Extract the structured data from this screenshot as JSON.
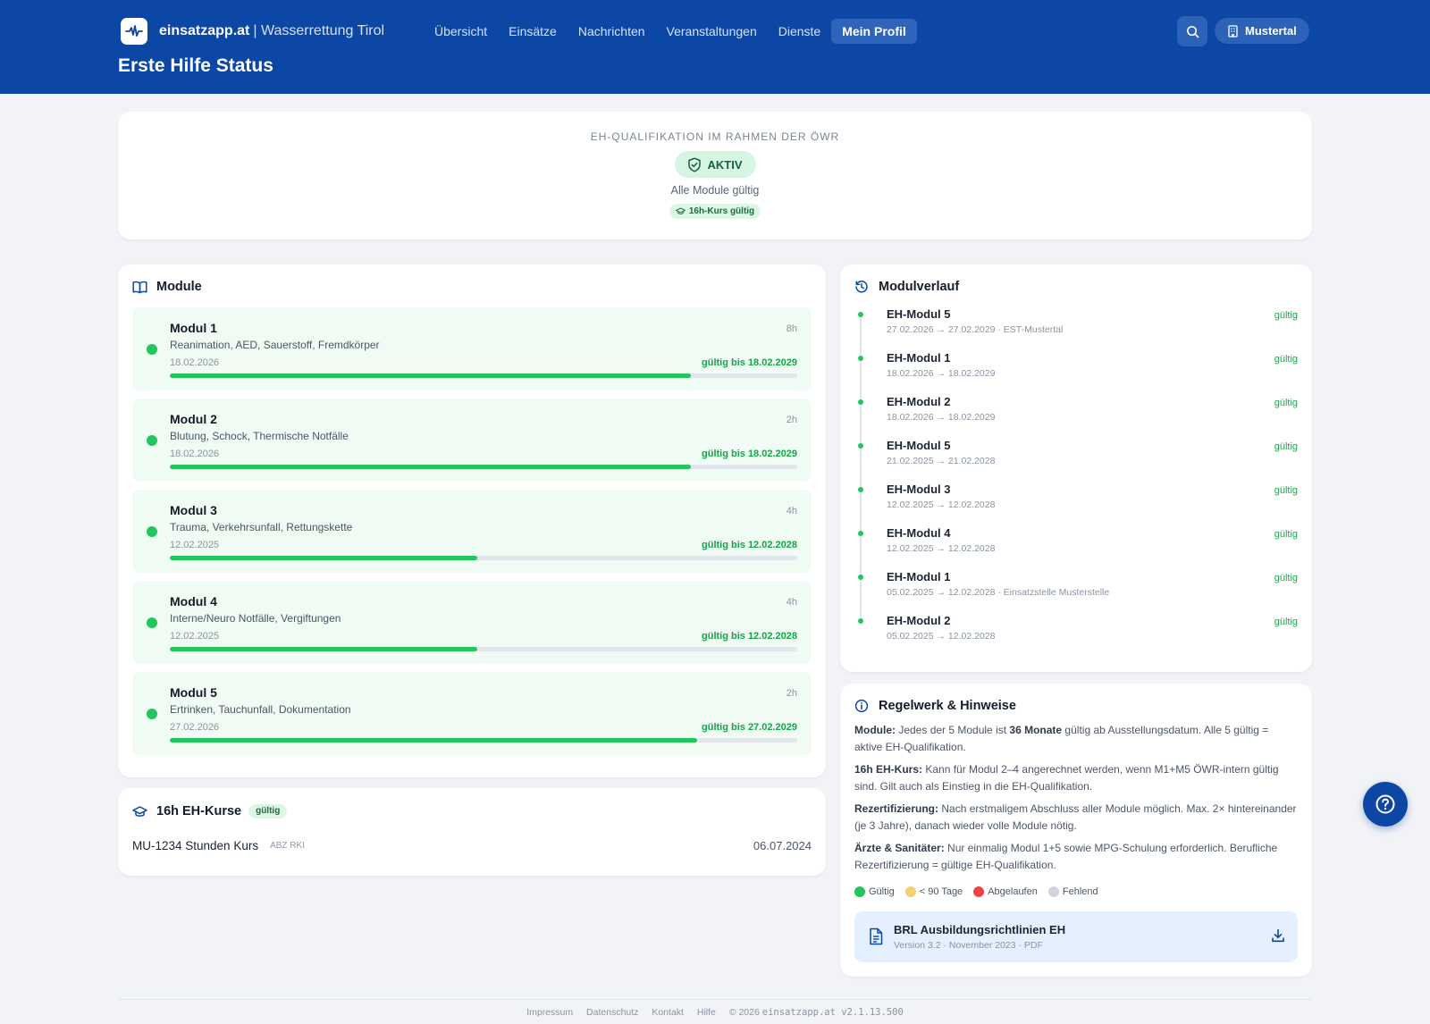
{
  "app": {
    "brand_name": "einsatzapp.at",
    "brand_sub": "| Wasserrettung Tirol",
    "page_title": "Erste Hilfe Status"
  },
  "nav": [
    {
      "label": "Übersicht",
      "active": false
    },
    {
      "label": "Einsätze",
      "active": false
    },
    {
      "label": "Nachrichten",
      "active": false
    },
    {
      "label": "Veranstaltungen",
      "active": false
    },
    {
      "label": "Dienste",
      "active": false
    },
    {
      "label": "Mein Profil",
      "active": true
    }
  ],
  "header_actions": {
    "search_icon": "search-icon",
    "org_label": "Mustertal",
    "org_icon": "building-icon"
  },
  "status": {
    "kicker": "EH-Qualifikation im Rahmen der ÖWR",
    "state": "AKTIV",
    "subtitle": "Alle Module gültig",
    "course_chip": "16h-Kurs gültig"
  },
  "modules_section": {
    "title": "Module",
    "items": [
      {
        "title": "Modul 1",
        "hours": "8h",
        "desc": "Reanimation, AED, Sauerstoff, Fremdkörper",
        "date": "18.02.2026",
        "valid": "gültig bis 18.02.2029",
        "progress": 0.83
      },
      {
        "title": "Modul 2",
        "hours": "2h",
        "desc": "Blutung, Schock, Thermische Notfälle",
        "date": "18.02.2026",
        "valid": "gültig bis 18.02.2029",
        "progress": 0.83
      },
      {
        "title": "Modul 3",
        "hours": "4h",
        "desc": "Trauma, Verkehrsunfall, Rettungskette",
        "date": "12.02.2025",
        "valid": "gültig bis 12.02.2028",
        "progress": 0.49
      },
      {
        "title": "Modul 4",
        "hours": "4h",
        "desc": "Interne/Neuro Notfälle, Vergiftungen",
        "date": "12.02.2025",
        "valid": "gültig bis 12.02.2028",
        "progress": 0.49
      },
      {
        "title": "Modul 5",
        "hours": "2h",
        "desc": "Ertrinken, Tauchunfall, Dokumentation",
        "date": "27.02.2026",
        "valid": "gültig bis 27.02.2029",
        "progress": 0.84
      }
    ]
  },
  "courses_section": {
    "title": "16h EH-Kurse",
    "tag": "gültig",
    "items": [
      {
        "name": "MU-1234 Stunden Kurs",
        "org": "ABZ RKI",
        "date": "06.07.2024"
      }
    ]
  },
  "history_section": {
    "title": "Modulverlauf",
    "items": [
      {
        "title": "EH-Modul 5",
        "meta": "27.02.2026 → 27.02.2029 · EST-Mustertal",
        "status": "gültig"
      },
      {
        "title": "EH-Modul 1",
        "meta": "18.02.2026 → 18.02.2029",
        "status": "gültig"
      },
      {
        "title": "EH-Modul 2",
        "meta": "18.02.2026 → 18.02.2029",
        "status": "gültig"
      },
      {
        "title": "EH-Modul 5",
        "meta": "21.02.2025 → 21.02.2028",
        "status": "gültig"
      },
      {
        "title": "EH-Modul 3",
        "meta": "12.02.2025 → 12.02.2028",
        "status": "gültig"
      },
      {
        "title": "EH-Modul 4",
        "meta": "12.02.2025 → 12.02.2028",
        "status": "gültig"
      },
      {
        "title": "EH-Modul 1",
        "meta": "05.02.2025 → 12.02.2028 · Einsatzstelle Musterstelle",
        "status": "gültig"
      },
      {
        "title": "EH-Modul 2",
        "meta": "05.02.2025 → 12.02.2028",
        "status": "gültig"
      }
    ]
  },
  "rules_section": {
    "title": "Regelwerk & Hinweise",
    "rules": [
      {
        "label": "Module:",
        "pre": " Jedes der 5 Module ist ",
        "bold": "36 Monate",
        "post": " gültig ab Ausstellungsdatum. Alle 5 gültig = aktive EH-Qualifikation."
      },
      {
        "label": "16h EH-Kurs:",
        "pre": " Kann für Modul 2–4 angerechnet werden, wenn M1+M5 ÖWR-intern gültig sind. Gilt auch als Einstieg in die EH-Qualifikation.",
        "bold": "",
        "post": ""
      },
      {
        "label": "Rezertifizierung:",
        "pre": " Nach erstmaligem Abschluss aller Module möglich. Max. 2× hintereinander (je 3 Jahre), danach wieder volle Module nötig.",
        "bold": "",
        "post": ""
      },
      {
        "label": "Ärzte & Sanitäter:",
        "pre": " Nur einmalig Modul 1+5 sowie MPG-Schulung erforderlich. Berufliche Rezertifizierung = gültige EH-Qualifikation.",
        "bold": "",
        "post": ""
      }
    ],
    "legend": [
      {
        "label": "Gültig",
        "color": "#22c55e"
      },
      {
        "label": "< 90 Tage",
        "color": "#f4d06f"
      },
      {
        "label": "Abgelaufen",
        "color": "#ef4444"
      },
      {
        "label": "Fehlend",
        "color": "#d1d5db"
      }
    ],
    "document": {
      "title": "BRL Ausbildungsrichtlinien EH",
      "meta": "Version 3.2 · November 2023 · PDF"
    }
  },
  "footer": {
    "links": [
      "Impressum",
      "Datenschutz",
      "Kontakt",
      "Hilfe"
    ],
    "copyright": "© 2026",
    "version": "einsatzapp.at v2.1.13.500"
  },
  "colors": {
    "primary": "#0d47a6",
    "success": "#22c55e",
    "success_text": "#17a34a"
  }
}
